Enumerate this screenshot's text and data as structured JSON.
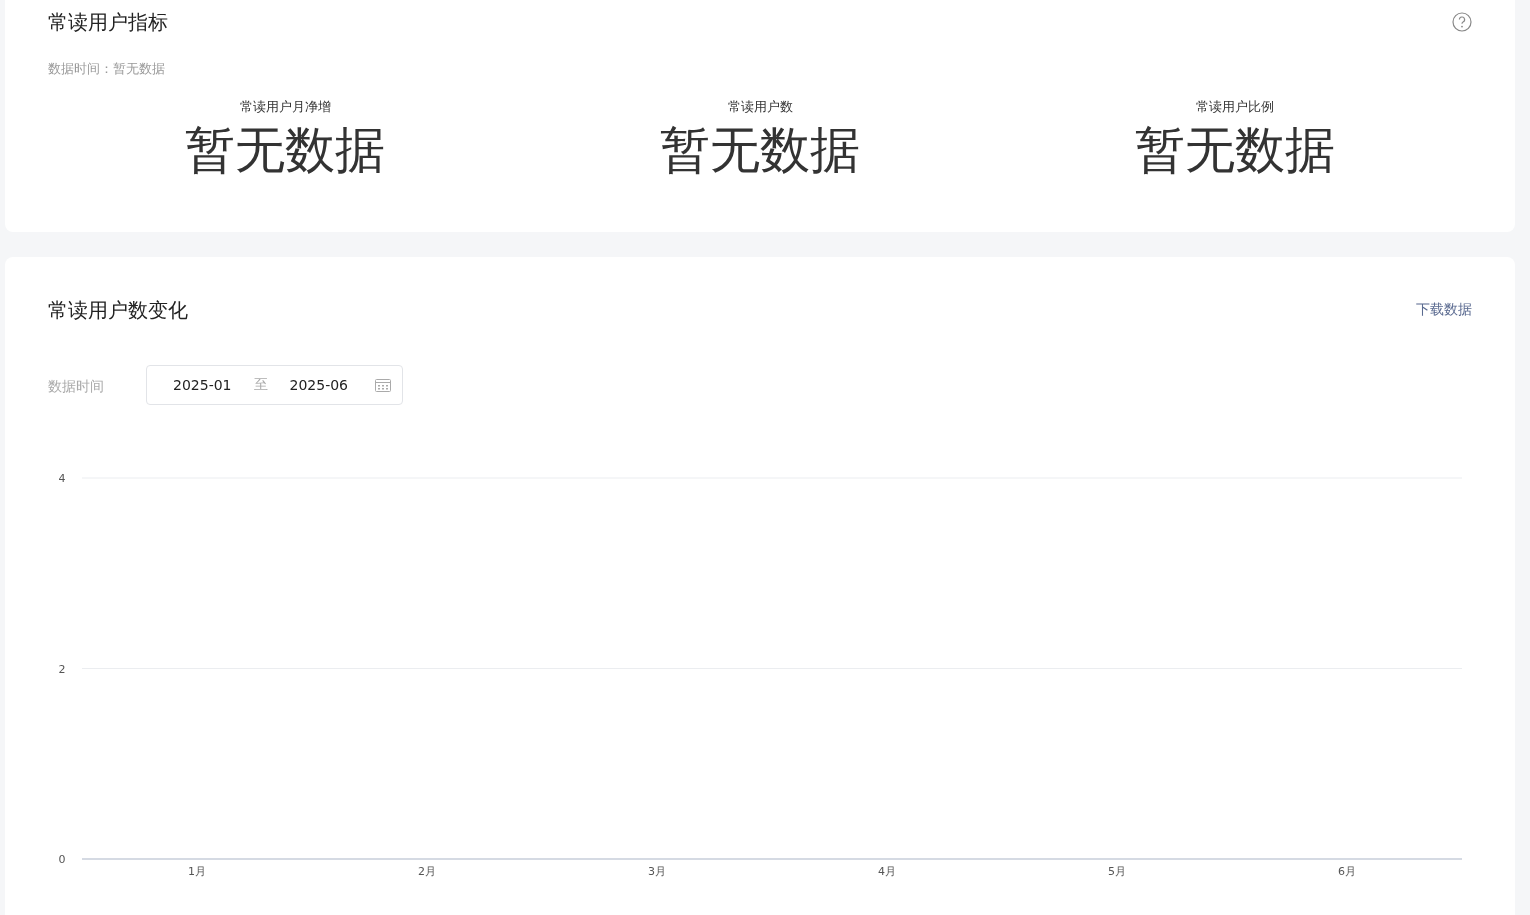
{
  "metrics_card": {
    "title": "常读用户指标",
    "data_time": "数据时间：暂无数据",
    "metrics": [
      {
        "label": "常读用户月净增",
        "value": "暂无数据"
      },
      {
        "label": "常读用户数",
        "value": "暂无数据"
      },
      {
        "label": "常读用户比例",
        "value": "暂无数据"
      }
    ]
  },
  "trend_card": {
    "title": "常读用户数变化",
    "download_link": "下载数据",
    "date_label": "数据时间",
    "date_range": {
      "start": "2025-01",
      "separator": "至",
      "end": "2025-06"
    },
    "chart_data": {
      "type": "line",
      "categories": [
        "1月",
        "2月",
        "3月",
        "4月",
        "5月",
        "6月"
      ],
      "ylim": [
        0,
        4
      ],
      "yticks": [
        0,
        2,
        4
      ]
    }
  }
}
